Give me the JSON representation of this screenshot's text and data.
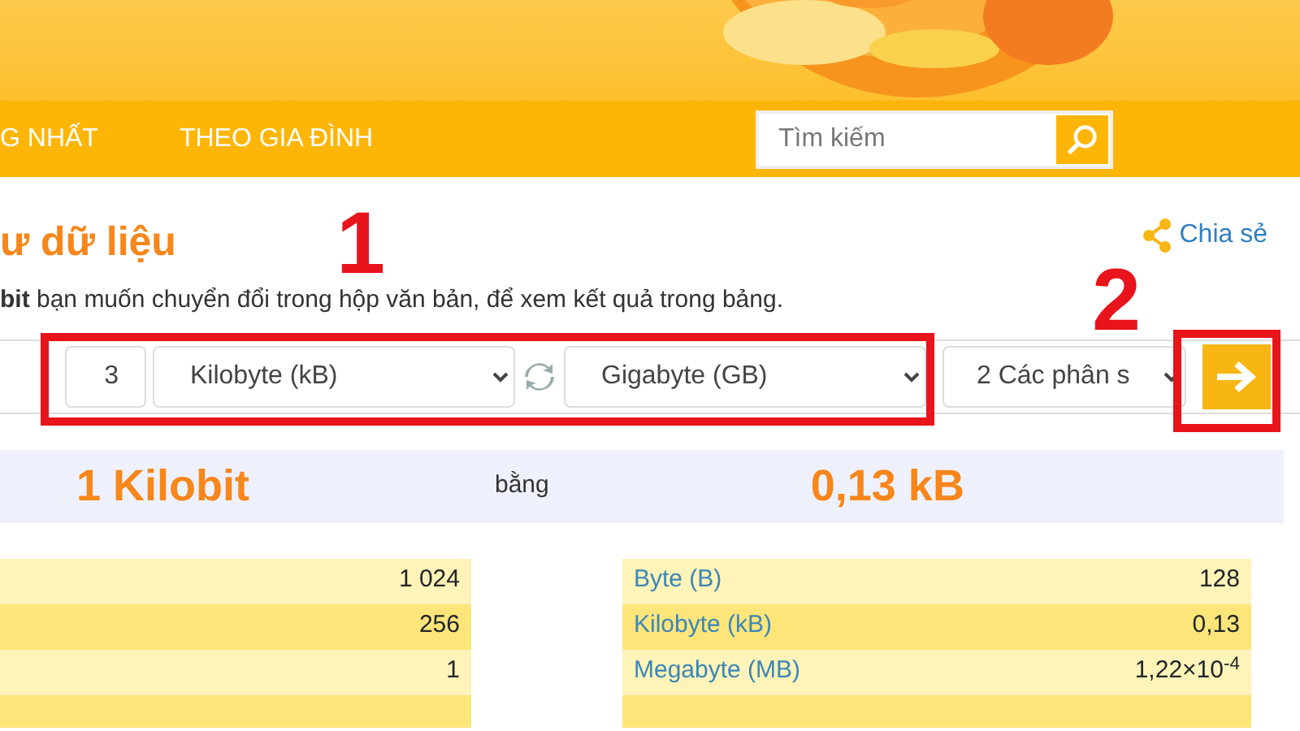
{
  "nav": {
    "items": [
      {
        "label": "G NHẤT"
      },
      {
        "label": "THEO GIA ĐÌNH"
      }
    ],
    "search": {
      "placeholder": "Tìm kiếm"
    }
  },
  "heading": "ư dữ liệu",
  "share": "Chia sẻ",
  "description": "**bit** bạn muốn chuyển đổi trong hộp văn bản, để xem kết quả trong bảng.",
  "form": {
    "amount": "3",
    "from_unit": "Kilobyte (kB)",
    "to_unit": "Gigabyte (GB)",
    "decimals": "2 Các phân s"
  },
  "annotations": [
    {
      "number": "1"
    },
    {
      "number": "2"
    }
  ],
  "result": {
    "left": "1 Kilobit",
    "middle": "bằng",
    "right": "0,13 kB"
  },
  "left_table": {
    "rows": [
      {
        "value": "1 024"
      },
      {
        "value": "256"
      },
      {
        "value": "1"
      },
      {
        "value": ""
      }
    ]
  },
  "right_table": {
    "rows": [
      {
        "unit": "Byte (B)",
        "value": "128"
      },
      {
        "unit": "Kilobyte (kB)",
        "value": "0,13"
      },
      {
        "unit": "Megabyte (MB)",
        "value": "1,22×10$^{-4}$"
      },
      {
        "unit": "",
        "value": ""
      }
    ]
  }
}
